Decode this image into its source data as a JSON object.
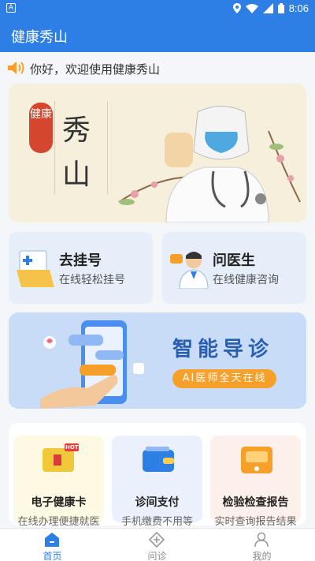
{
  "status_bar": {
    "left_badge": "A",
    "time": "8:06"
  },
  "app_bar": {
    "title": "健康秀山"
  },
  "notice": {
    "text": "你好，欢迎使用健康秀山"
  },
  "banner": {
    "seal_text": "健康",
    "char_1": "秀",
    "char_2": "山"
  },
  "quick_actions": [
    {
      "title": "去挂号",
      "subtitle": "在线轻松挂号"
    },
    {
      "title": "问医生",
      "subtitle": "在线健康咨询"
    }
  ],
  "guide": {
    "title": "智能导诊",
    "tag": "AI医师全天在线"
  },
  "services": [
    {
      "title": "电子健康卡",
      "subtitle": "在线办理便捷就医",
      "badge": "HOT"
    },
    {
      "title": "诊间支付",
      "subtitle": "手机缴费不用等"
    },
    {
      "title": "检验检查报告",
      "subtitle": "实时查询报告结果"
    }
  ],
  "tabs": [
    {
      "label": "首页"
    },
    {
      "label": "问诊"
    },
    {
      "label": "我的"
    }
  ],
  "colors": {
    "primary": "#2d7fe6",
    "accent": "#f6a02a"
  }
}
